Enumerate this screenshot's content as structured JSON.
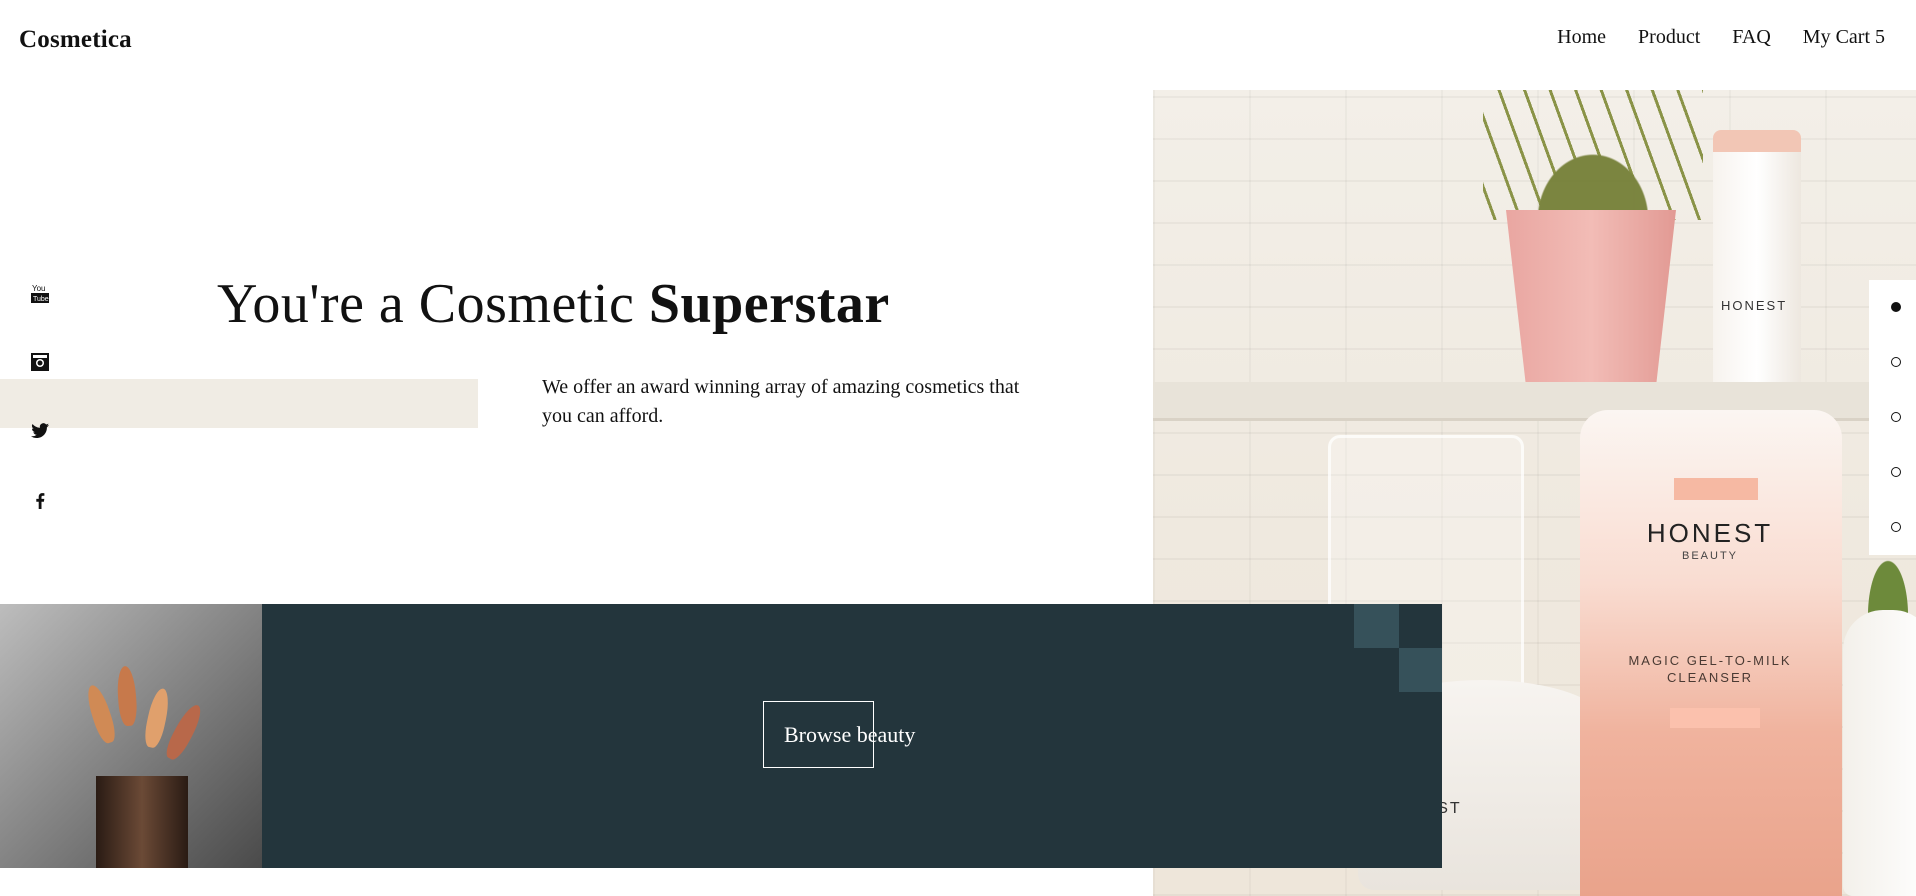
{
  "brand": {
    "name": "Cosmetica"
  },
  "nav": {
    "items": [
      "Home",
      "Product",
      "FAQ",
      "My Cart 5"
    ]
  },
  "hero": {
    "title_regular": "You're a Cosmetic ",
    "title_bold": "Superstar",
    "description": "We offer an award winning array of amazing cosmetics that you can afford."
  },
  "social": {
    "icons": [
      "youtube-icon",
      "instagram-icon",
      "twitter-icon",
      "facebook-icon"
    ]
  },
  "slider": {
    "count": 5,
    "active_index": 0
  },
  "product_photo": {
    "stick_brand": "HONEST",
    "tube_brand": "HONEST",
    "tube_sub": "BEAUTY",
    "tube_name_line1": "MAGIC GEL-TO-MILK",
    "tube_name_line2": "CLEANSER",
    "jar_brand": "HONEST"
  },
  "cta": {
    "label": "Browse beauty"
  },
  "colors": {
    "band": "#23353c",
    "beige": "#f0ece4",
    "deco": "#36515a"
  }
}
